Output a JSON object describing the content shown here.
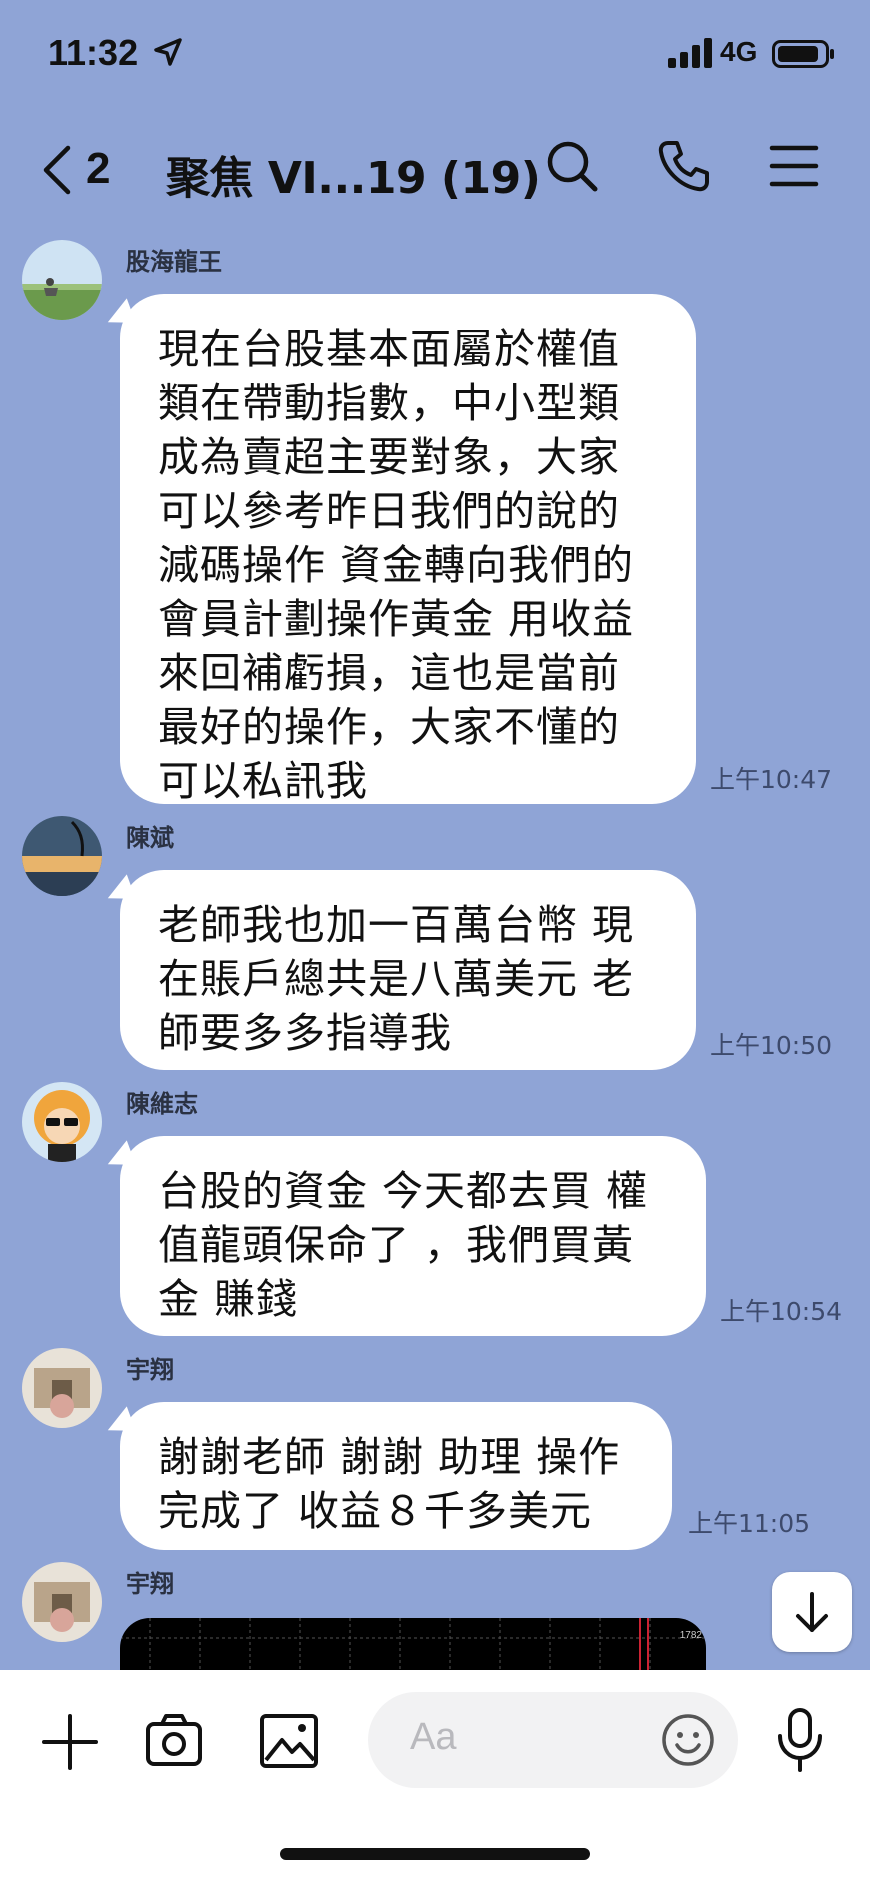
{
  "status_bar": {
    "time": "11:32",
    "network": "4G"
  },
  "header": {
    "back_count": "2",
    "title": "聚焦 VI...19 (19)"
  },
  "messages": [
    {
      "sender": "股海龍王",
      "text": "現在台股基本面屬於權值\n類在帶動指數，中小型類\n成為賣超主要對象，大家\n可以參考昨日我們的說的\n減碼操作 資金轉向我們的\n會員計劃操作黃金 用收益\n來回補虧損，這也是當前\n最好的操作，大家不懂的\n可以私訊我",
      "time": "上午10:47"
    },
    {
      "sender": "陳斌",
      "text": "老師我也加一百萬台幣 現\n在賬戶總共是八萬美元 老\n師要多多指導我",
      "time": "上午10:50"
    },
    {
      "sender": "陳維志",
      "text": "台股的資金 今天都去買 權\n值龍頭保命了 ，我們買黃\n金 賺錢",
      "time": "上午10:54"
    },
    {
      "sender": "宇翔",
      "text": "謝謝老師 謝謝 助理 操作\n完成了 收益８千多美元",
      "time": "上午11:05"
    },
    {
      "sender": "宇翔",
      "image_label": "1782"
    }
  ],
  "composer": {
    "placeholder": "Aa"
  },
  "colors": {
    "background": "#8fa4d6",
    "bubble": "#ffffff"
  }
}
